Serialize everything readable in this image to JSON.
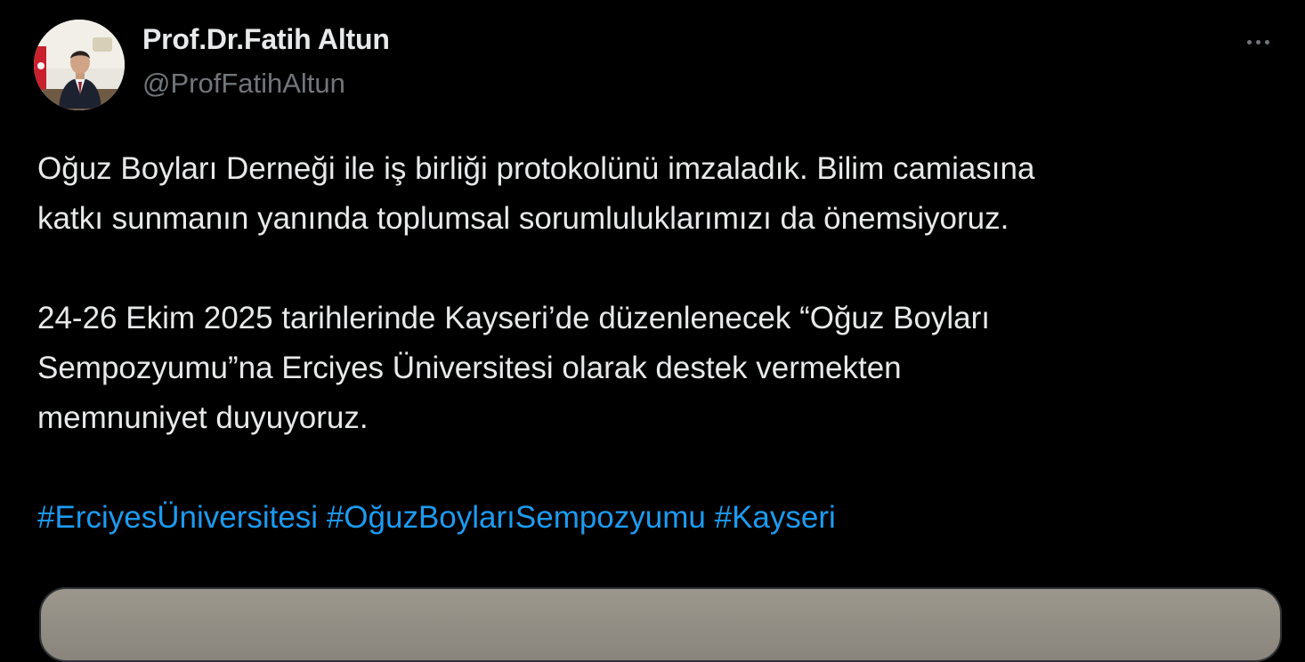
{
  "author": {
    "display_name": "Prof.Dr.Fatih Altun",
    "handle": "@ProfFatihAltun",
    "avatar_icon": "profile-photo"
  },
  "menu": {
    "more_icon": "more-horizontal-icon"
  },
  "tweet": {
    "paragraph1": [
      "Oğuz Boyları Derneği ile iş birliği protokolünü imzaladık. Bilim camiasına",
      "katkı sunmanın yanında toplumsal sorumluluklarımızı da önemsiyoruz."
    ],
    "paragraph2": [
      "24-26 Ekim 2025 tarihlerinde Kayseri’de düzenlenecek “Oğuz Boyları",
      "Sempozyumu”na Erciyes Üniversitesi olarak destek vermekten",
      "memnuniyet duyuyoruz."
    ],
    "hashtags": [
      "#ErciyesÜniversitesi",
      "#OğuzBoylarıSempozyumu",
      "#Kayseri"
    ]
  },
  "colors": {
    "background": "#000000",
    "text": "#e7e9ea",
    "secondary": "#71767b",
    "link": "#1d9bf0"
  }
}
